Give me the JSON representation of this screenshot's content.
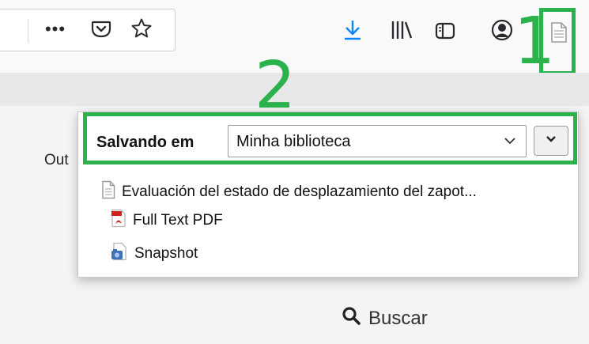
{
  "toolbar": {
    "page_actions_label": "•••",
    "icons": [
      "pocket-icon",
      "star-icon",
      "download-icon",
      "library-icon",
      "sidebar-icon",
      "account-icon",
      "zotero-page-icon"
    ],
    "accent": "#0a84ff"
  },
  "annotations": {
    "one": "1",
    "two": "2",
    "color": "#2bb24c"
  },
  "page": {
    "left_text": "Out",
    "search_label": "Buscar"
  },
  "popup": {
    "save_label": "Salvando em",
    "collection": "Minha biblioteca",
    "item_title": "Evaluación del estado de desplazamiento del zapot...",
    "attachments": [
      "Full Text PDF",
      "Snapshot"
    ]
  }
}
